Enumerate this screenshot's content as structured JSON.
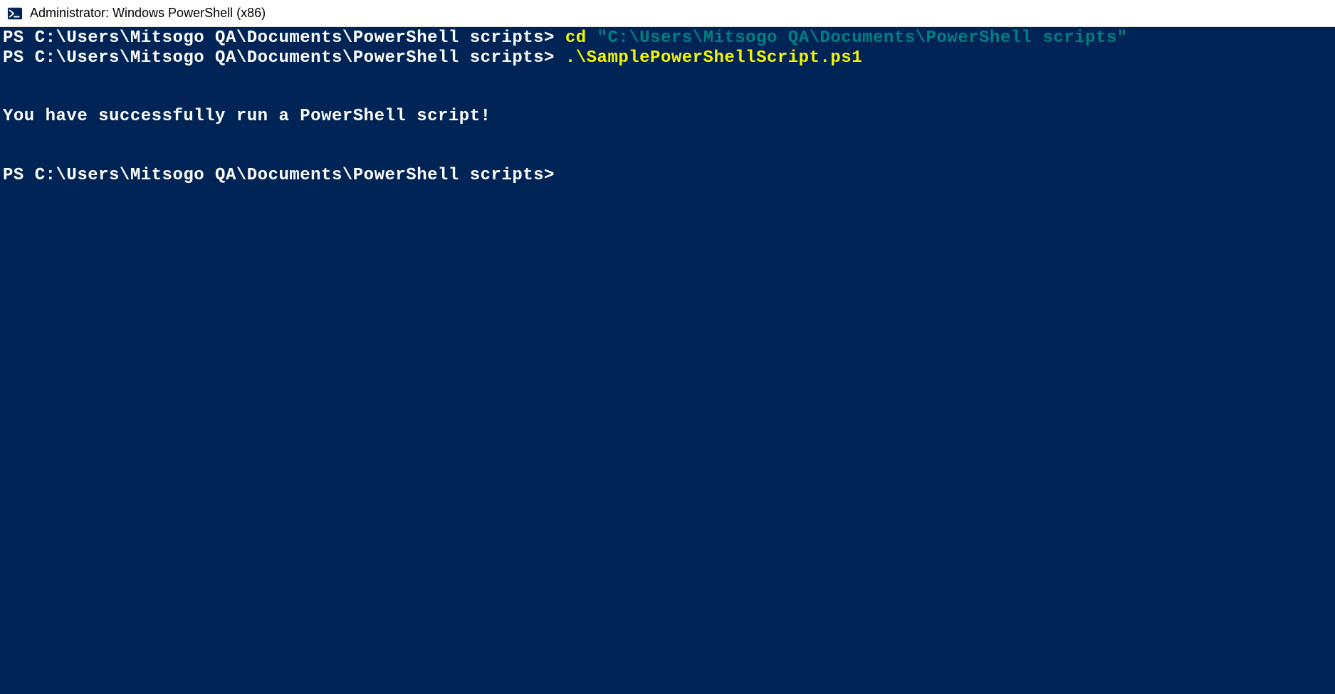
{
  "window": {
    "title": "Administrator: Windows PowerShell (x86)"
  },
  "terminal": {
    "line1": {
      "prompt": "PS C:\\Users\\Mitsogo QA\\Documents\\PowerShell scripts> ",
      "cmd": "cd ",
      "arg": "\"C:\\Users\\Mitsogo QA\\Documents\\PowerShell scripts\""
    },
    "line2": {
      "prompt": "PS C:\\Users\\Mitsogo QA\\Documents\\PowerShell scripts> ",
      "cmd": ".\\SamplePowerShellScript.ps1"
    },
    "output": "You have successfully run a PowerShell script!",
    "line3": {
      "prompt": "PS C:\\Users\\Mitsogo QA\\Documents\\PowerShell scripts>"
    }
  }
}
